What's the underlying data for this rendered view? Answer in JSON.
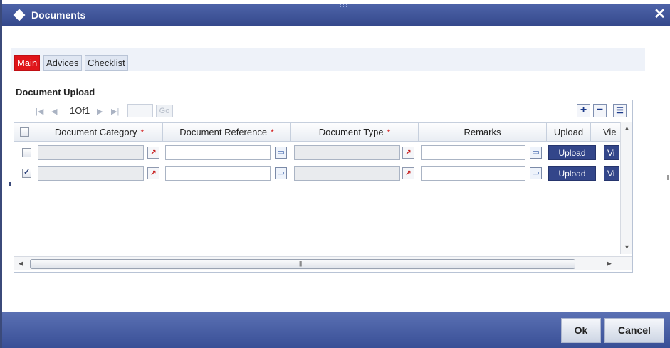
{
  "window": {
    "title": "Documents",
    "close_glyph": "✕"
  },
  "tabs": [
    {
      "label": "Main",
      "active": true
    },
    {
      "label": "Advices",
      "active": false
    },
    {
      "label": "Checklist",
      "active": false
    }
  ],
  "section": {
    "title": "Document Upload"
  },
  "pager": {
    "text": "1Of1",
    "go_label": "Go",
    "page_value": ""
  },
  "toolbar": {
    "add_glyph": "+",
    "delete_glyph": "−",
    "view_glyph": "☰"
  },
  "columns": [
    {
      "label": "Document Category",
      "required": true
    },
    {
      "label": "Document Reference",
      "required": true
    },
    {
      "label": "Document Type",
      "required": true
    },
    {
      "label": "Remarks",
      "required": false
    },
    {
      "label": "Upload",
      "required": false
    },
    {
      "label": "Vie",
      "required": false
    }
  ],
  "required_marker": "*",
  "rows": [
    {
      "checked": false,
      "category": "",
      "reference": "",
      "type": "",
      "remarks": "",
      "upload_label": "Upload",
      "view_label": "Vi"
    },
    {
      "checked": true,
      "category": "",
      "reference": "",
      "type": "",
      "remarks": "",
      "upload_label": "Upload",
      "view_label": "Vi"
    }
  ],
  "footer": {
    "ok_label": "Ok",
    "cancel_label": "Cancel"
  },
  "colors": {
    "titlebar": "#3f55a0",
    "active_tab": "#e0151a",
    "button_blue": "#33468a"
  }
}
